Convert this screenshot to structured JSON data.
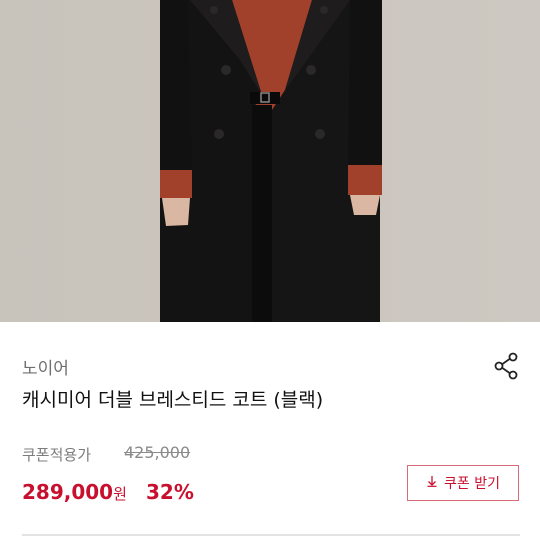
{
  "product": {
    "brand": "노이어",
    "name": "캐시미어 더블 브레스티드 코트 (블랙)",
    "coupon_price_label": "쿠폰적용가",
    "original_price": "425,000",
    "sale_price": "289,000",
    "currency": "원",
    "discount": "32%"
  },
  "actions": {
    "coupon_button_label": "쿠폰 받기",
    "share_icon": "share-icon",
    "download_icon": "download-arrow-icon"
  },
  "colors": {
    "accent": "#c8102e",
    "coat": "#151414",
    "sweater": "#a2412b",
    "background_wall": "#c9c4bd"
  }
}
